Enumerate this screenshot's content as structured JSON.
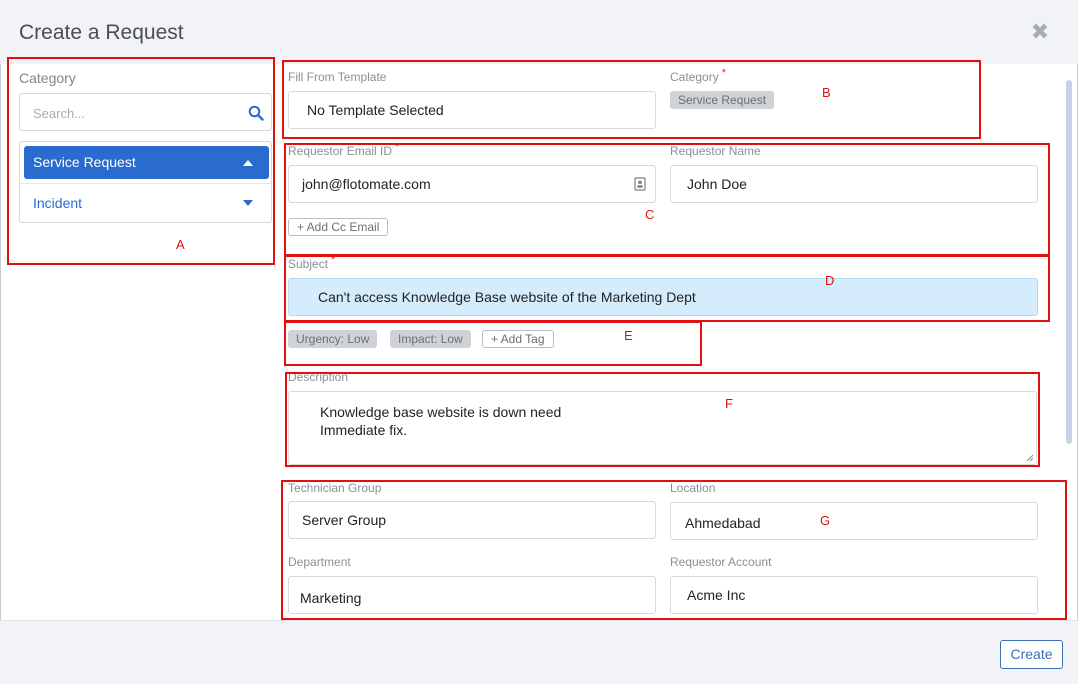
{
  "dialog": {
    "title": "Create a Request",
    "close_glyph": "✖",
    "create_label": "Create"
  },
  "sidebar": {
    "category_label": "Category",
    "search_placeholder": "Search...",
    "items": [
      {
        "label": "Service Request",
        "active": true
      },
      {
        "label": "Incident",
        "active": false
      }
    ]
  },
  "form": {
    "fill_from_template": {
      "label": "Fill From Template",
      "value": "No Template Selected"
    },
    "category": {
      "label": "Category",
      "required_mark": "*",
      "chip": "Service Request"
    },
    "requestor_email": {
      "label": "Requestor Email ID",
      "required_mark": "*",
      "value": "john@flotomate.com"
    },
    "requestor_name": {
      "label": "Requestor Name",
      "value": "John Doe"
    },
    "add_cc_email_label": "+ Add Cc Email",
    "subject": {
      "label": "Subject",
      "required_mark": "*",
      "value": "Can't access Knowledge Base website of the Marketing Dept"
    },
    "tags": {
      "urgency": "Urgency: Low",
      "impact": "Impact: Low",
      "add_tag_label": "+ Add Tag"
    },
    "description": {
      "label": "Description",
      "value": "Knowledge base website is down need\nImmediate fix."
    },
    "technician_group": {
      "label": "Technician Group",
      "value": "Server Group"
    },
    "location": {
      "label": "Location",
      "value": "Ahmedabad"
    },
    "department": {
      "label": "Department",
      "value": "Marketing"
    },
    "requestor_account": {
      "label": "Requestor Account",
      "value": "Acme Inc"
    }
  },
  "annotations": {
    "a": "A",
    "b": "B",
    "c": "C",
    "d": "D",
    "e": "E",
    "f": "F",
    "g": "G"
  },
  "colors": {
    "primary": "#2a6bd0",
    "annotation": "#e01010",
    "subject_bg": "#d4ecfb",
    "header_bg": "#f1f3f6"
  },
  "icons": {
    "search": "search-icon",
    "close": "close-icon",
    "contact": "contact-card-icon",
    "caret_up": "caret-up-icon",
    "caret_down": "caret-down-icon"
  }
}
